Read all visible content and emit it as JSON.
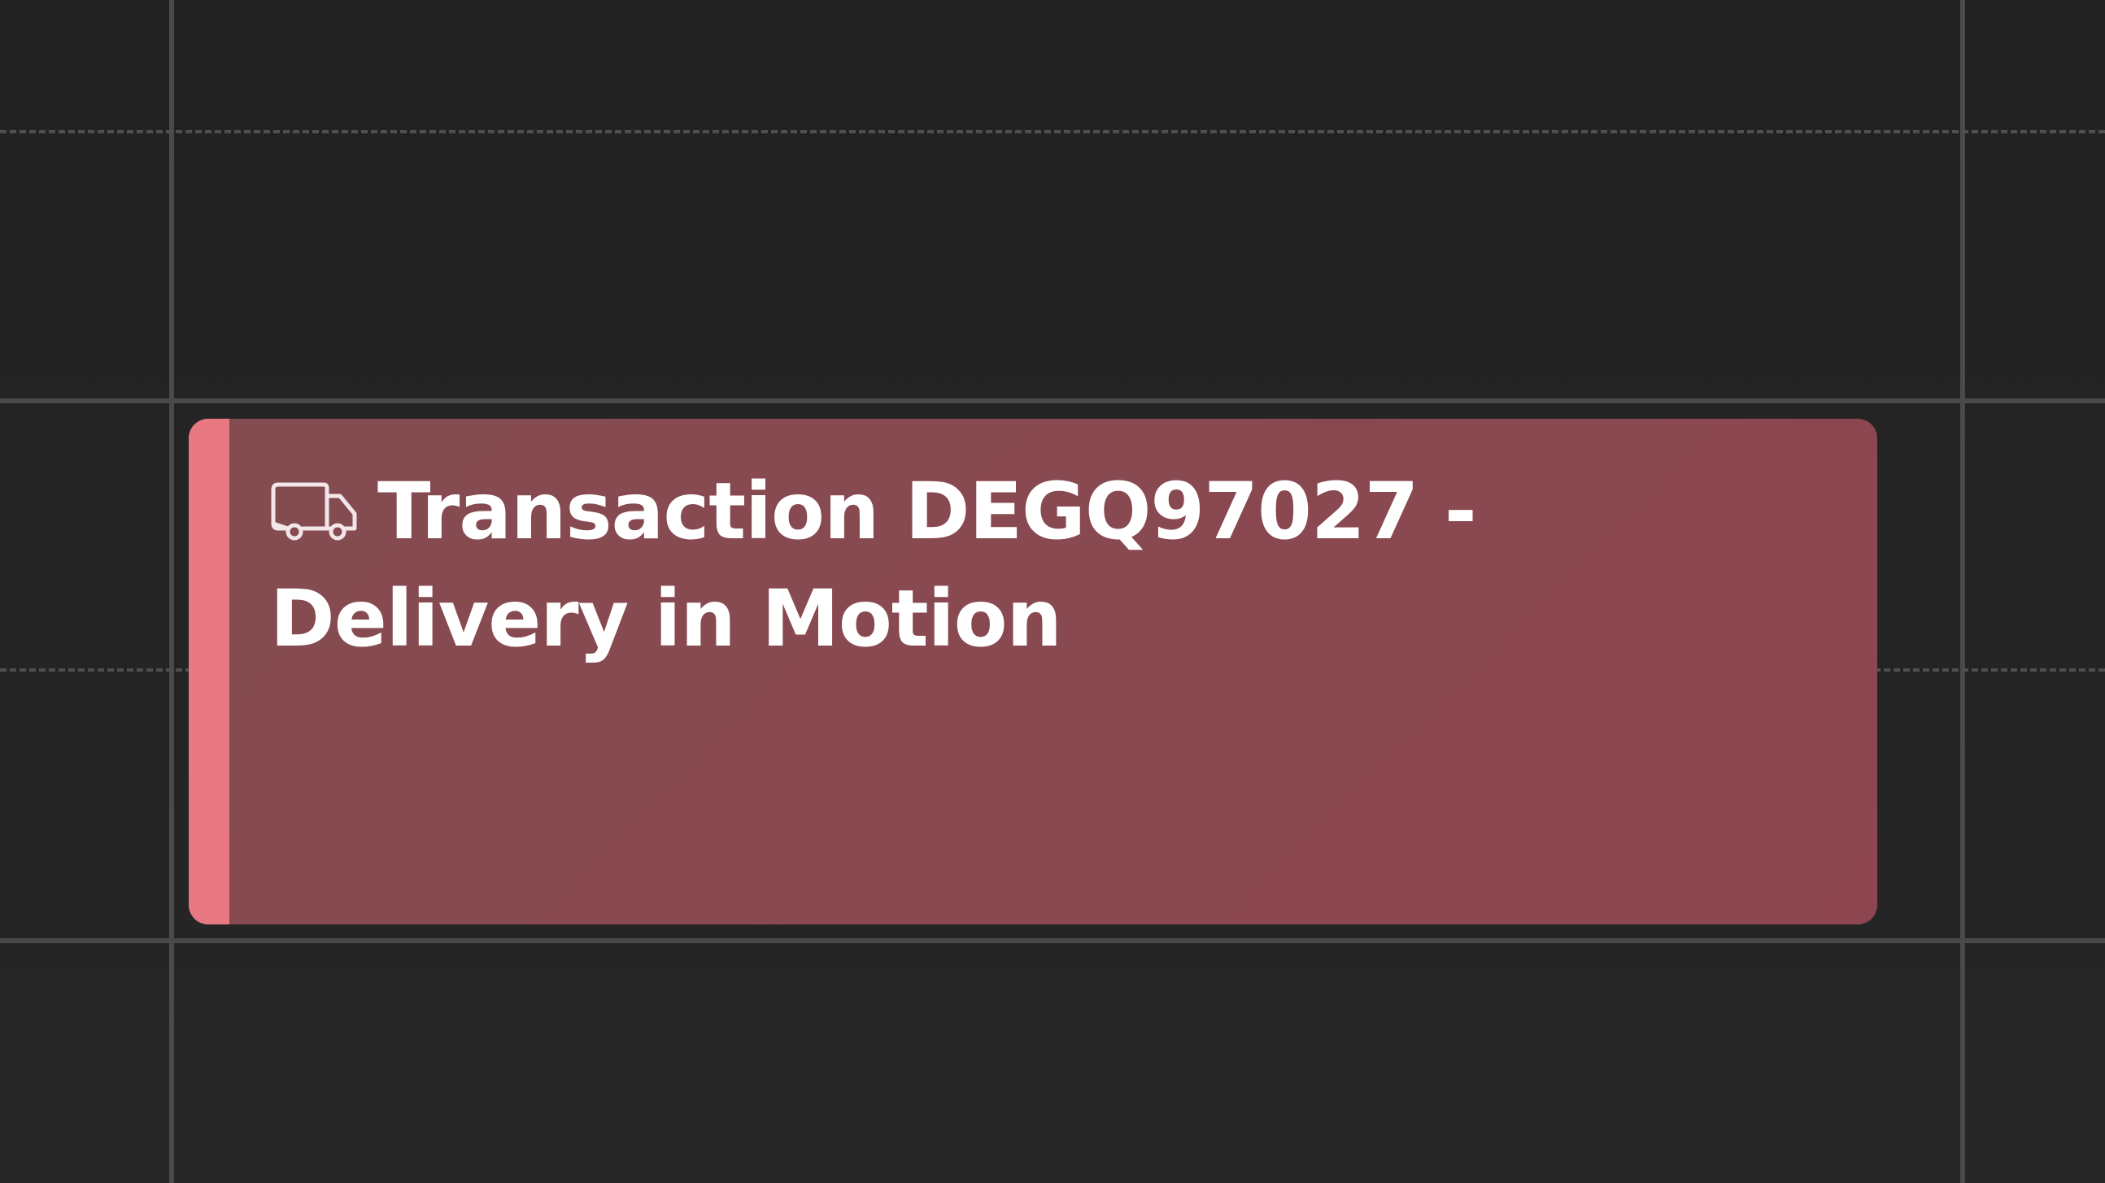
{
  "calendar": {
    "background_color": "#242424",
    "grid_line_color": "#4a4a4a"
  },
  "event": {
    "icon": "truck-icon",
    "title": "Transaction DEGQ97027 - Delivery in Motion",
    "background_color": "#8a4850",
    "accent_color": "#e87882",
    "text_color": "#ffffff"
  }
}
